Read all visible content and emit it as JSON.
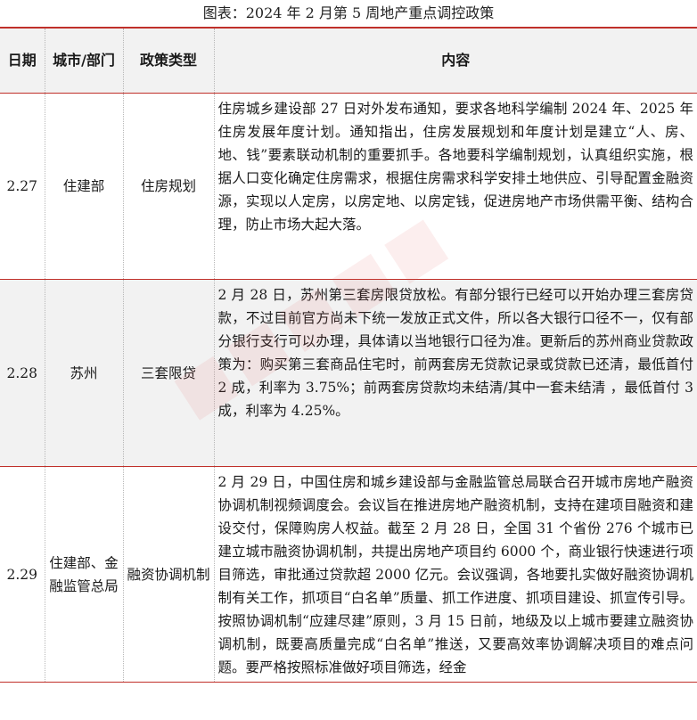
{
  "caption": "图表：2024 年 2 月第 5 周地产重点调控政策",
  "headers": {
    "date": "日期",
    "city": "城市/部门",
    "type": "政策类型",
    "content": "内容"
  },
  "rows": [
    {
      "date": "2.27",
      "city": "住建部",
      "type": "住房规划",
      "content": "住房城乡建设部 27 日对外发布通知，要求各地科学编制 2024 年、2025 年住房发展年度计划。通知指出，住房发展规划和年度计划是建立“人、房、地、钱”要素联动机制的重要抓手。各地要科学编制规划，认真组织实施，根据人口变化确定住房需求，根据住房需求科学安排土地供应、引导配置金融资源，实现以人定房，以房定地、以房定钱，促进房地产市场供需平衡、结构合理，防止市场大起大落。"
    },
    {
      "date": "2.28",
      "city": "苏州",
      "type": "三套限贷",
      "content": "2 月 28 日，苏州第三套房限贷放松。有部分银行已经可以开始办理三套房贷款，不过目前官方尚未下统一发放正式文件，所以各大银行口径不一，仅有部分银行支行可以办理，具体请以当地银行口径为准。更新后的苏州商业贷款政策为：购买第三套商品住宅时，前两套房无贷款记录或贷款已还清，最低首付 2 成，利率为 3.75%；前两套房贷款均未结清/其中一套未结清 ，最低首付 3 成，利率为 4.25%。"
    },
    {
      "date": "2.29",
      "city": "住建部、金融监管总局",
      "type": "融资协调机制",
      "content": "2 月 29 日，中国住房和城乡建设部与金融监管总局联合召开城市房地产融资协调机制视频调度会。会议旨在推进房地产融资机制，支持在建项目融资和建设交付，保障购房人权益。截至 2 月 28 日，全国 31 个省份 276 个城市已建立城市融资协调机制，共提出房地产项目约 6000 个，商业银行快速进行项目筛选，审批通过贷款超 2000 亿元。会议强调，各地要扎实做好融资协调机制有关工作，抓项目“白名单”质量、抓工作进度、抓项目建设、抓宣传引导。按照协调机制“应建尽建”原则，3 月 15 日前，地级及以上城市要建立融资协调机制，既要高质量完成“白名单”推送，又要高效率协调解决项目的难点问题。要严格按照标准做好项目筛选，经金"
    }
  ]
}
